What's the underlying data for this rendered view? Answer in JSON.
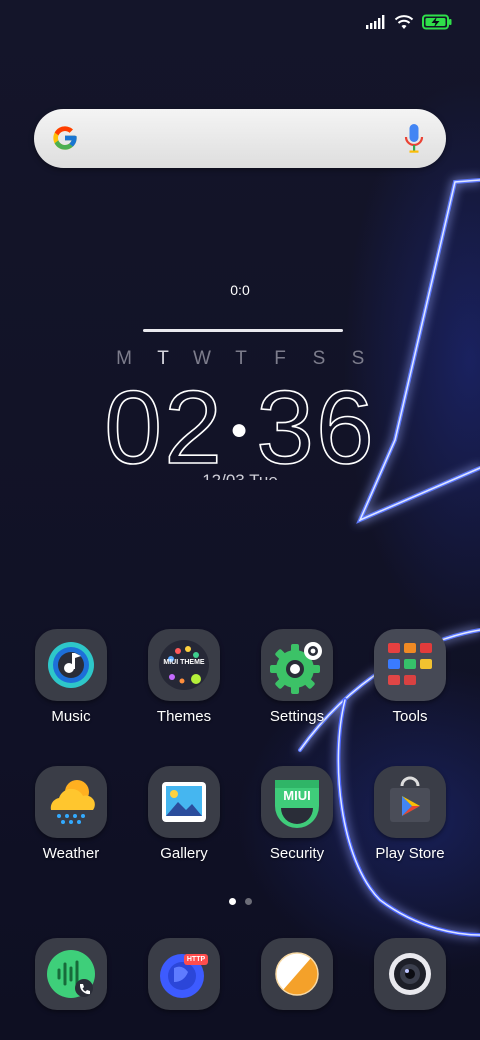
{
  "status_bar": {
    "icons": [
      "signal-icon",
      "wifi-icon",
      "battery-charging-icon"
    ]
  },
  "search": {
    "icons": [
      "google-icon",
      "mic-icon"
    ]
  },
  "widget": {
    "music_time": "0:0",
    "weekdays": [
      "M",
      "T",
      "W",
      "T",
      "F",
      "S",
      "S"
    ],
    "active_day_index": 1,
    "hour": "02",
    "minute": "36",
    "date": "12/03 Tue"
  },
  "apps_row1": [
    {
      "label": "Music",
      "icon": "music-icon"
    },
    {
      "label": "Themes",
      "icon": "themes-icon"
    },
    {
      "label": "Settings",
      "icon": "settings-icon"
    },
    {
      "label": "Tools",
      "icon": "tools-folder-icon"
    }
  ],
  "apps_row2": [
    {
      "label": "Weather",
      "icon": "weather-icon"
    },
    {
      "label": "Gallery",
      "icon": "gallery-icon"
    },
    {
      "label": "Security",
      "icon": "security-icon"
    },
    {
      "label": "Play Store",
      "icon": "play-store-icon"
    }
  ],
  "themes_badge": "MIUI THEME",
  "security_badge": "MIUI",
  "browser_badge": "HTTP",
  "dock": [
    {
      "icon": "phone-icon"
    },
    {
      "icon": "browser-icon"
    },
    {
      "icon": "notes-icon"
    },
    {
      "icon": "camera-icon"
    }
  ],
  "pages": {
    "count": 2,
    "active": 0
  },
  "colors": {
    "tile": "#3a3d47",
    "accent_green": "#2fbf5f",
    "accent_blue": "#3a5bff"
  }
}
